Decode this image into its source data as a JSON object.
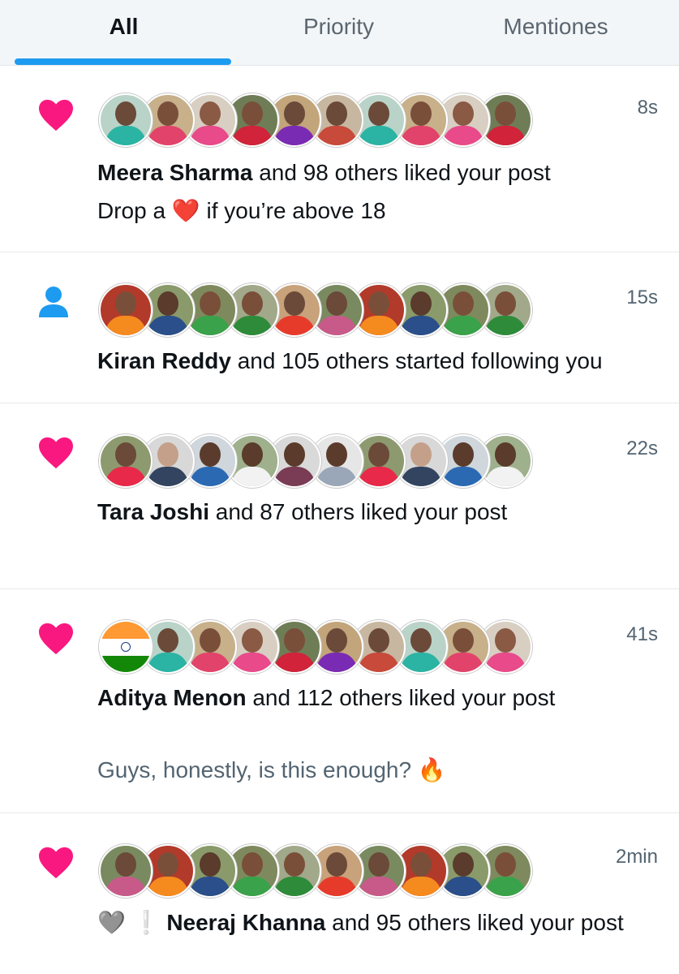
{
  "tabs": [
    {
      "label": "All"
    },
    {
      "label": "Priority"
    },
    {
      "label": "Mentiones"
    }
  ],
  "notifications": [
    {
      "type_icon": "heart-icon",
      "time": "8s",
      "name": "Meera Sharma",
      "action": "and 98 others liked your post",
      "post_text_before": "Drop a",
      "post_emoji": "❤️",
      "post_text_after": "if you’re above 18"
    },
    {
      "type_icon": "person-icon",
      "time": "15s",
      "name": "Kiran Reddy",
      "action": "and 105 others started following you"
    },
    {
      "type_icon": "heart-icon",
      "time": "22s",
      "name": "Tara Joshi",
      "action": "and 87 others liked your post"
    },
    {
      "type_icon": "heart-icon",
      "time": "41s",
      "name": "Aditya Menon",
      "action": "and 112 others liked your post",
      "post_text": "Guys, honestly, is this enough?",
      "post_emoji": "🔥"
    },
    {
      "type_icon": "heart-icon",
      "time": "2min",
      "prefix_emoji": "🩶",
      "prefix_mark": "❕",
      "name": "Neeraj Khanna",
      "action": "and 95 others liked your post"
    }
  ],
  "colors": {
    "accent": "#1d9bf0",
    "like": "#f91880",
    "follow": "#1d9bf0"
  }
}
